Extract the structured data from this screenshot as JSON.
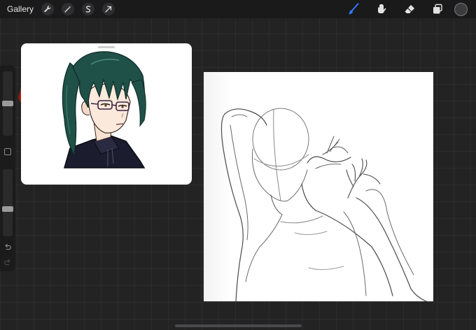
{
  "topbar": {
    "gallery_label": "Gallery",
    "left_tools": [
      {
        "name": "actions-wrench-icon"
      },
      {
        "name": "adjustments-wand-icon"
      },
      {
        "name": "selection-s-icon"
      },
      {
        "name": "transform-arrow-icon"
      }
    ],
    "right_tools": [
      {
        "name": "brush-icon",
        "active_color": "#2f7bf5"
      },
      {
        "name": "smudge-icon"
      },
      {
        "name": "eraser-icon"
      },
      {
        "name": "layers-icon"
      }
    ],
    "current_color": "#3c3c3e"
  },
  "sidebar": {
    "brush_size_level": 0.5,
    "opacity_level": 0.4
  },
  "reference": {
    "hair_color": "#1f5148",
    "uniform_color": "#1b1c2e"
  },
  "colors": {
    "background": "#232324",
    "accent": "#2f7bf5"
  }
}
